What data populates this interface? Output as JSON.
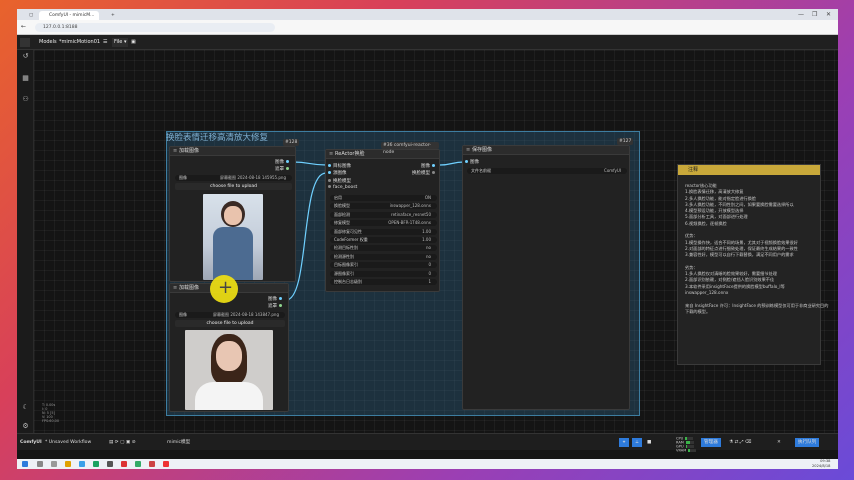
{
  "browser": {
    "tab_title": "ComfyUI - mimicM...",
    "new_tab": "+",
    "url": "127.0.0.1:8188",
    "window_controls": [
      "—",
      "❐",
      "✕"
    ]
  },
  "topbar": {
    "logo": "",
    "menu": "Models",
    "workflow_name": "*mimicMotion01",
    "file_label": "File ▾"
  },
  "group": {
    "title": "换脸表情迁移高清放大修复"
  },
  "nodes": {
    "load1": {
      "title": "加载图像",
      "badge": "#128",
      "outputs": [
        "图像",
        "遮罩"
      ],
      "image_label": "图像",
      "image_value": "屏幕截图 2024-08-18 145955.png",
      "upload": "choose file to upload"
    },
    "load2": {
      "title": "加载图像",
      "badge": "#120",
      "outputs": [
        "图像",
        "遮罩"
      ],
      "image_label": "图像",
      "image_value": "屏幕截图 2024-08-18 143847.png",
      "upload": "choose file to upload"
    },
    "reactor": {
      "title": "ReActor换脸",
      "group_badge": "#36 comfyui-reactor-node",
      "inputs": [
        "目标图像",
        "源图像",
        "换脸模型",
        "face_boost"
      ],
      "outputs": [
        "图像",
        "换脸模型"
      ],
      "widgets": [
        {
          "label": "启用",
          "value": "ON"
        },
        {
          "label": "换脸模型",
          "value": "inswapper_128.onnx"
        },
        {
          "label": "面部检测",
          "value": "retinaface_resnet50"
        },
        {
          "label": "修复模型",
          "value": "OPEN-BFR-1T48.onnx"
        },
        {
          "label": "面部修复可见性",
          "value": "1.00"
        },
        {
          "label": "CodeFormer 权重",
          "value": "1.00"
        },
        {
          "label": "检测目标性别",
          "value": "no"
        },
        {
          "label": "检测源性别",
          "value": "no"
        },
        {
          "label": "目标图像索引",
          "value": "0"
        },
        {
          "label": "源图像索引",
          "value": "0"
        },
        {
          "label": "控制台日志级别",
          "value": "1"
        }
      ]
    },
    "save": {
      "title": "保存图像",
      "badge": "#127",
      "input": "图像",
      "prefix_label": "文件名前缀",
      "prefix_value": "ComfyUI"
    },
    "note": {
      "title": "注释",
      "lines": [
        "reactor核心功能",
        "1.换脸表情迁移，高清放大修复",
        "2.多人换脸功能，能对指定脸进行换脸",
        "3.多人换脸功能，不同性别之间，如果要换脸需要选择所以",
        "4.模型预设功能，开放模型选择",
        "5.面部分析工具，对面部进行处理",
        "6.视频换脸，逐帧换脸",
        "",
        "优势：",
        "1.模型操作快，适合不同的场景，尤其对于视频换脸效果很好",
        "2.对面部的特征点进行细致处理，保证最终生成结果的一致性",
        "3.兼容性好，模型可以自行下载替换，满足不同用户的需求",
        "",
        "劣势：",
        "1.多人换脸仅对清晰的脸效果较好，需要细节处理",
        "2.面部识别依赖，对侧脸/遮挡人脸识别效果不佳",
        "3.本软件采用insightFace提供的换脸模型buffalo_l等",
        "inswapper_128.onnx",
        "",
        "来自 InsightFace 许可：InsightFace 的预训练模型仅可用于非商业研究目的",
        "下载的模型。"
      ]
    }
  },
  "bottombar": {
    "brand": "ComfyUI",
    "workflow": "* Unsaved Workflow",
    "center": "mimic模型",
    "queue": "管理器",
    "run": "执行队列",
    "sysmon": [
      {
        "label": "CPU",
        "value": 0.2
      },
      {
        "label": "RAM",
        "value": 0.45
      },
      {
        "label": "GPU",
        "value": 0.1
      },
      {
        "label": "VRAM",
        "value": 0.15
      },
      {
        "label": "Temp",
        "value": 0.3
      }
    ]
  },
  "statusbar": {
    "lines": [
      "T: 0.00s",
      "I: 0",
      "N: 5 [5]",
      "V: 100",
      "FPS:60.00"
    ]
  },
  "taskbar": {
    "time": "09:38",
    "date": "2024/8/18"
  },
  "colors": {
    "accent_blue": "#2e7bdc",
    "link_blue": "#6fd0ff",
    "group_border": "#3d7da0",
    "note_header": "#c8a83a",
    "cursor_yellow": "#f0e114"
  }
}
